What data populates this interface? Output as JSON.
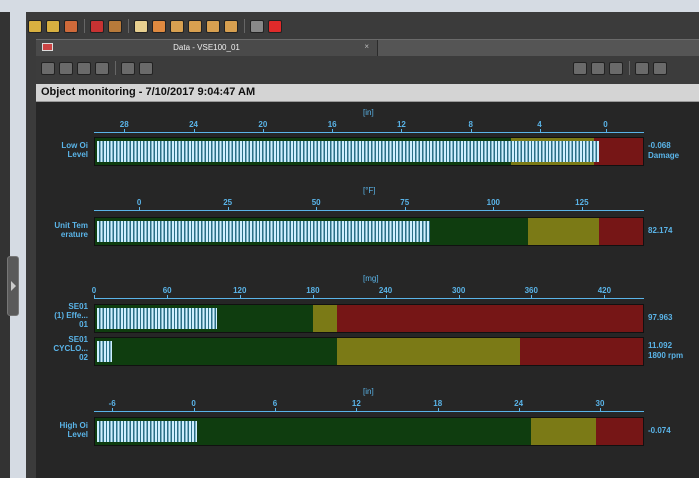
{
  "toolbar": {
    "icons": [
      {
        "name": "add-connection-icon",
        "color": "#d8b040"
      },
      {
        "name": "add-device-icon",
        "color": "#d8b040"
      },
      {
        "name": "copy-icon",
        "color": "#d06a3a"
      },
      {
        "name": "stop-circle-icon",
        "color": "#c83232"
      },
      {
        "name": "refresh-icon",
        "color": "#b87a3a"
      },
      {
        "name": "message-icon",
        "color": "#e8d090"
      },
      {
        "name": "record-icon",
        "color": "#e08a40"
      },
      {
        "name": "export-icon",
        "color": "#d8a050"
      },
      {
        "name": "import-icon",
        "color": "#d8a050"
      },
      {
        "name": "report-icon",
        "color": "#d8a050"
      },
      {
        "name": "settings-icon",
        "color": "#d8a050"
      },
      {
        "name": "play-icon",
        "color": "#888888"
      },
      {
        "name": "stop-record-icon",
        "color": "#e02a2a"
      }
    ]
  },
  "tab": {
    "title": "Data - VSE100_01",
    "close": "×"
  },
  "subbar": {
    "left_icons": [
      "layout-icon",
      "chart-settings-icon",
      "table-icon",
      "list-icon",
      "zoom-in-icon",
      "zoom-out-icon"
    ],
    "right_icons": [
      "record-icon",
      "pause-icon",
      "stop-icon",
      "step-icon",
      "stop-all-icon"
    ]
  },
  "header": {
    "title": "Object monitoring - 7/10/2017 9:04:47 AM"
  },
  "colors": {
    "green": "#0f3d0f",
    "yellow": "#7b7a16",
    "red": "#761616",
    "text": "#5ab4e8"
  },
  "gauges": [
    {
      "unit": "[in]",
      "ticks": [
        "28",
        "24",
        "20",
        "16",
        "12",
        "8",
        "4",
        "0"
      ],
      "rows": [
        {
          "label": "Low Oi\nLevel",
          "value": "-0.068\nDamage",
          "fill_fraction": 0.92
        }
      ]
    },
    {
      "unit": "[°F]",
      "ticks": [
        "0",
        "25",
        "50",
        "75",
        "100",
        "125"
      ],
      "rows": [
        {
          "label": "Unit Tem\nerature",
          "value": "82.174",
          "fill_fraction": 0.61
        }
      ]
    },
    {
      "unit": "[mg]",
      "ticks": [
        "0",
        "60",
        "120",
        "180",
        "240",
        "300",
        "360",
        "420"
      ],
      "rows": [
        {
          "label": "SE01\n(1) Effe...\n01",
          "value": "97.963",
          "fill_fraction": 0.22
        },
        {
          "label": "SE01\nCYCLO...\n02",
          "value": "11.092\n1800 rpm",
          "fill_fraction": 0.027
        }
      ]
    },
    {
      "unit": "[in]",
      "ticks": [
        "-6",
        "0",
        "6",
        "12",
        "18",
        "24",
        "30"
      ],
      "rows": [
        {
          "label": "High Oi\nLevel",
          "value": "-0.074",
          "fill_fraction": 0.183
        }
      ]
    }
  ]
}
